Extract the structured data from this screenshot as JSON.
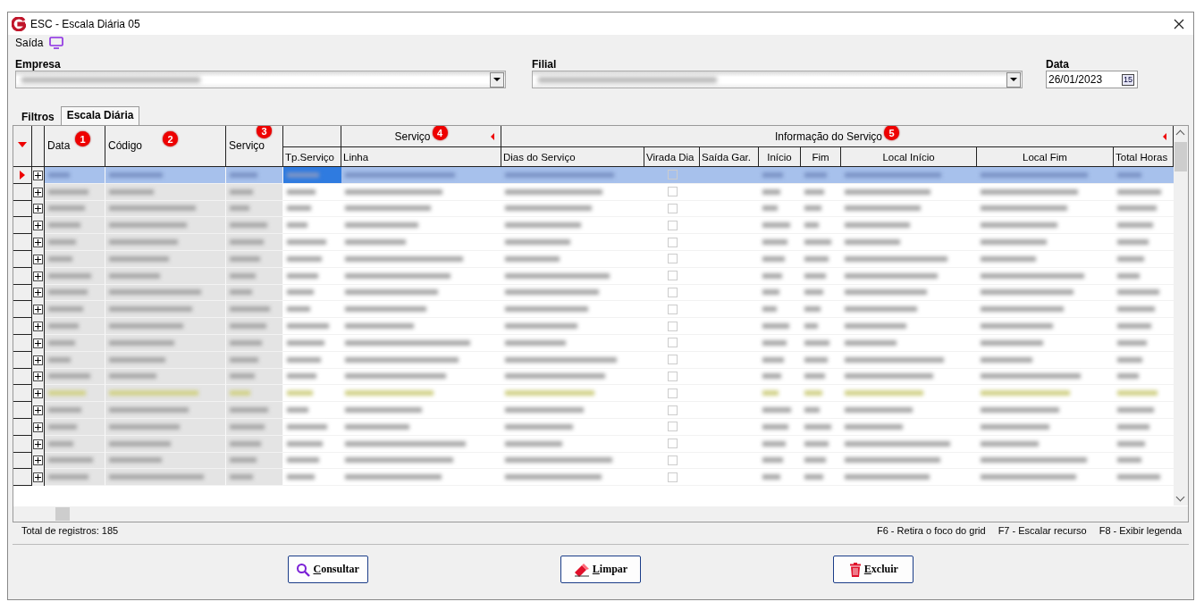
{
  "window": {
    "title": "ESC - Escala Diária 05"
  },
  "menu": [
    {
      "label": "Saída"
    }
  ],
  "filters": {
    "empresa": {
      "label": "Empresa"
    },
    "filial": {
      "label": "Filial"
    },
    "data": {
      "label": "Data",
      "value": "26/01/2023",
      "calendar_label": "15"
    }
  },
  "tabs": [
    {
      "label": "Filtros",
      "selected": false
    },
    {
      "label": "Escala Diária",
      "selected": true
    }
  ],
  "grid": {
    "fixed_columns": [
      {
        "label": "Data",
        "badge": "1",
        "kind": "text"
      },
      {
        "label": "Código",
        "badge": "2",
        "kind": "text"
      },
      {
        "label": "Serviço",
        "badge": "3",
        "kind": "text"
      }
    ],
    "column_groups": [
      {
        "collapsible": false,
        "columns": [
          {
            "label": "Tp.Serviço",
            "kind": "text"
          }
        ]
      },
      {
        "label": "Serviço",
        "badge": "4",
        "collapsible": true,
        "columns": [
          {
            "label": "Linha",
            "kind": "text"
          }
        ]
      },
      {
        "label": "Informação do Serviço",
        "badge": "5",
        "collapsible": true,
        "columns": [
          {
            "label": "Dias do Serviço",
            "kind": "text"
          },
          {
            "label": "Virada Dia",
            "kind": "check"
          },
          {
            "label": "Saída Gar.",
            "kind": "empty"
          },
          {
            "label": "Início",
            "kind": "text"
          },
          {
            "label": "Fim",
            "kind": "text"
          },
          {
            "label": "Local Início",
            "kind": "text"
          },
          {
            "label": "Local Fim",
            "kind": "text"
          },
          {
            "label": "Total Horas",
            "kind": "text"
          }
        ]
      }
    ],
    "rows": [
      {
        "selected": true,
        "highlighted": false
      },
      {
        "selected": false,
        "highlighted": false
      },
      {
        "selected": false,
        "highlighted": false
      },
      {
        "selected": false,
        "highlighted": false
      },
      {
        "selected": false,
        "highlighted": false
      },
      {
        "selected": false,
        "highlighted": false
      },
      {
        "selected": false,
        "highlighted": false
      },
      {
        "selected": false,
        "highlighted": false
      },
      {
        "selected": false,
        "highlighted": false
      },
      {
        "selected": false,
        "highlighted": false
      },
      {
        "selected": false,
        "highlighted": false
      },
      {
        "selected": false,
        "highlighted": false
      },
      {
        "selected": false,
        "highlighted": false
      },
      {
        "selected": false,
        "highlighted": true
      },
      {
        "selected": false,
        "highlighted": false
      },
      {
        "selected": false,
        "highlighted": false
      },
      {
        "selected": false,
        "highlighted": false
      },
      {
        "selected": false,
        "highlighted": false
      },
      {
        "selected": false,
        "highlighted": false
      }
    ]
  },
  "status_bar": {
    "total": "Total de registros: 185",
    "hints": [
      "F6 - Retira o foco do grid",
      "F7 - Escalar recurso",
      "F8 - Exibir legenda"
    ]
  },
  "buttons": [
    {
      "label": "Consultar",
      "kind": "search"
    },
    {
      "label": "Limpar",
      "kind": "eraser"
    },
    {
      "label": "Excluir",
      "kind": "delete"
    }
  ]
}
